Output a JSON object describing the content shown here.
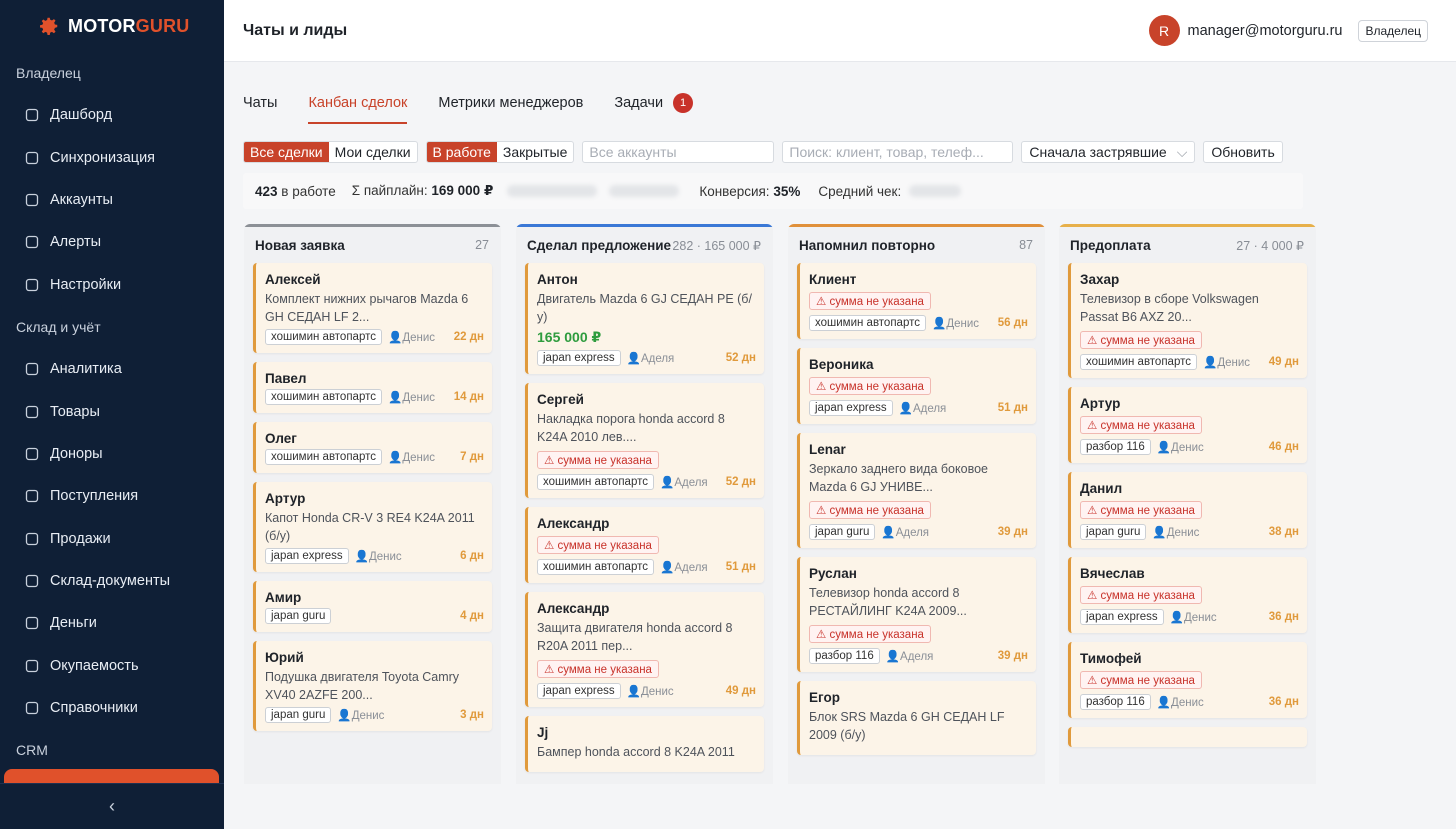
{
  "brand": {
    "motor": "MOTOR",
    "guru": "GURU"
  },
  "sidebar": {
    "section1": "Владелец",
    "items1": [
      "Дашборд",
      "Синхронизация",
      "Аккаунты",
      "Алерты",
      "Настройки"
    ],
    "section2": "Склад и учёт",
    "items2": [
      "Аналитика",
      "Товары",
      "Доноры",
      "Поступления",
      "Продажи",
      "Склад-документы",
      "Деньги",
      "Окупаемость",
      "Справочники"
    ],
    "section3": "CRM",
    "collapse": "‹"
  },
  "header": {
    "title": "Чаты и лиды",
    "avatar": "R",
    "email": "manager@motorguru.ru",
    "role": "Владелец"
  },
  "tabs": [
    {
      "label": "Чаты"
    },
    {
      "label": "Канбан сделок"
    },
    {
      "label": "Метрики менеджеров"
    },
    {
      "label": "Задачи",
      "badge": "1"
    }
  ],
  "toolbar": {
    "all_deals": "Все сделки",
    "my_deals": "Мои сделки",
    "in_work": "В работе",
    "closed": "Закрытые",
    "accounts_placeholder": "Все аккаунты",
    "search_placeholder": "Поиск: клиент, товар, телеф...",
    "sort": "Сначала застрявшие",
    "refresh": "Обновить"
  },
  "stats": {
    "in_work_count": "423",
    "in_work_label": "в работе",
    "pipeline_label": "Σ пайплайн:",
    "pipeline_value": "169 000 ₽",
    "conversion_label": "Конверсия:",
    "conversion_value": "35%",
    "avg_check_label": "Средний чек:"
  },
  "columns": [
    {
      "name": "Новая заявка",
      "count": "27",
      "color": "#8c9096",
      "cards": [
        {
          "name": "Алексей",
          "desc": "Комплект нижних рычагов Mazda 6 GH СЕДАН LF 2...",
          "tag": "хошимин автопартс",
          "manager": "Денис",
          "days": "22 дн"
        },
        {
          "name": "Павел",
          "tag": "хошимин автопартс",
          "manager": "Денис",
          "days": "14 дн"
        },
        {
          "name": "Олег",
          "tag": "хошимин автопартс",
          "manager": "Денис",
          "days": "7 дн"
        },
        {
          "name": "Артур",
          "desc": "Капот Honda CR-V 3 RE4 K24A 2011 (б/у)",
          "tag": "japan express",
          "manager": "Денис",
          "days": "6 дн"
        },
        {
          "name": "Амир",
          "tag": "japan guru",
          "days": "4 дн"
        },
        {
          "name": "Юрий",
          "desc": "Подушка двигателя Toyota Camry XV40 2AZFE 200...",
          "tag": "japan guru",
          "manager": "Денис",
          "days": "3 дн"
        }
      ]
    },
    {
      "name": "Сделал предложение",
      "count": "282 · 165 000 ₽",
      "color": "#3a78d6",
      "cards": [
        {
          "name": "Антон",
          "desc": "Двигатель Mazda 6 GJ СЕДАН PE (б/у)",
          "amount": "165 000 ₽",
          "tag": "japan express",
          "manager": "Аделя",
          "days": "52 дн"
        },
        {
          "name": "Сергей",
          "desc": "Накладка порога honda accord 8 K24A 2010 лев....",
          "warn": "⚠ сумма не указана",
          "tag": "хошимин автопартс",
          "manager": "Аделя",
          "days": "52 дн"
        },
        {
          "name": "Александр",
          "warn": "⚠ сумма не указана",
          "tag": "хошимин автопартс",
          "manager": "Аделя",
          "days": "51 дн"
        },
        {
          "name": "Александр",
          "desc": "Защита двигателя honda accord 8 R20A 2011 пер...",
          "warn": "⚠ сумма не указана",
          "tag": "japan express",
          "manager": "Денис",
          "days": "49 дн"
        },
        {
          "name": "Jj",
          "desc": "Бампер honda accord 8 K24A 2011"
        }
      ]
    },
    {
      "name": "Напомнил повторно",
      "count": "87",
      "color": "#e0903a",
      "cards": [
        {
          "name": "Клиент",
          "warn": "⚠ сумма не указана",
          "tag": "хошимин автопартс",
          "manager": "Денис",
          "days": "56 дн"
        },
        {
          "name": "Вероника",
          "warn": "⚠ сумма не указана",
          "tag": "japan express",
          "manager": "Аделя",
          "days": "51 дн"
        },
        {
          "name": "Lenar",
          "desc": "Зеркало заднего вида боковое Mazda 6 GJ УНИВЕ...",
          "warn": "⚠ сумма не указана",
          "tag": "japan guru",
          "manager": "Аделя",
          "days": "39 дн"
        },
        {
          "name": "Руслан",
          "desc": "Телевизор honda accord 8 РЕСТАЙЛИНГ K24A 2009...",
          "warn": "⚠ сумма не указана",
          "tag": "разбор 116",
          "manager": "Аделя",
          "days": "39 дн"
        },
        {
          "name": "Егор",
          "desc": "Блок SRS Mazda 6 GH СЕДАН LF 2009 (б/у)"
        }
      ]
    },
    {
      "name": "Предоплата",
      "count": "27 · 4 000 ₽",
      "color": "#e7b04a",
      "cards": [
        {
          "name": "Захар",
          "desc": "Телевизор в сборе Volkswagen Passat B6 AXZ 20...",
          "warn": "⚠ сумма не указана",
          "tag": "хошимин автопартс",
          "manager": "Денис",
          "days": "49 дн"
        },
        {
          "name": "Артур",
          "warn": "⚠ сумма не указана",
          "tag": "разбор 116",
          "manager": "Денис",
          "days": "46 дн"
        },
        {
          "name": "Данил",
          "warn": "⚠ сумма не указана",
          "tag": "japan guru",
          "manager": "Денис",
          "days": "38 дн"
        },
        {
          "name": "Вячеслав",
          "warn": "⚠ сумма не указана",
          "tag": "japan express",
          "manager": "Денис",
          "days": "36 дн"
        },
        {
          "name": "Тимофей",
          "warn": "⚠ сумма не указана",
          "tag": "разбор 116",
          "manager": "Денис",
          "days": "36 дн"
        },
        {
          "name": ""
        }
      ]
    }
  ]
}
